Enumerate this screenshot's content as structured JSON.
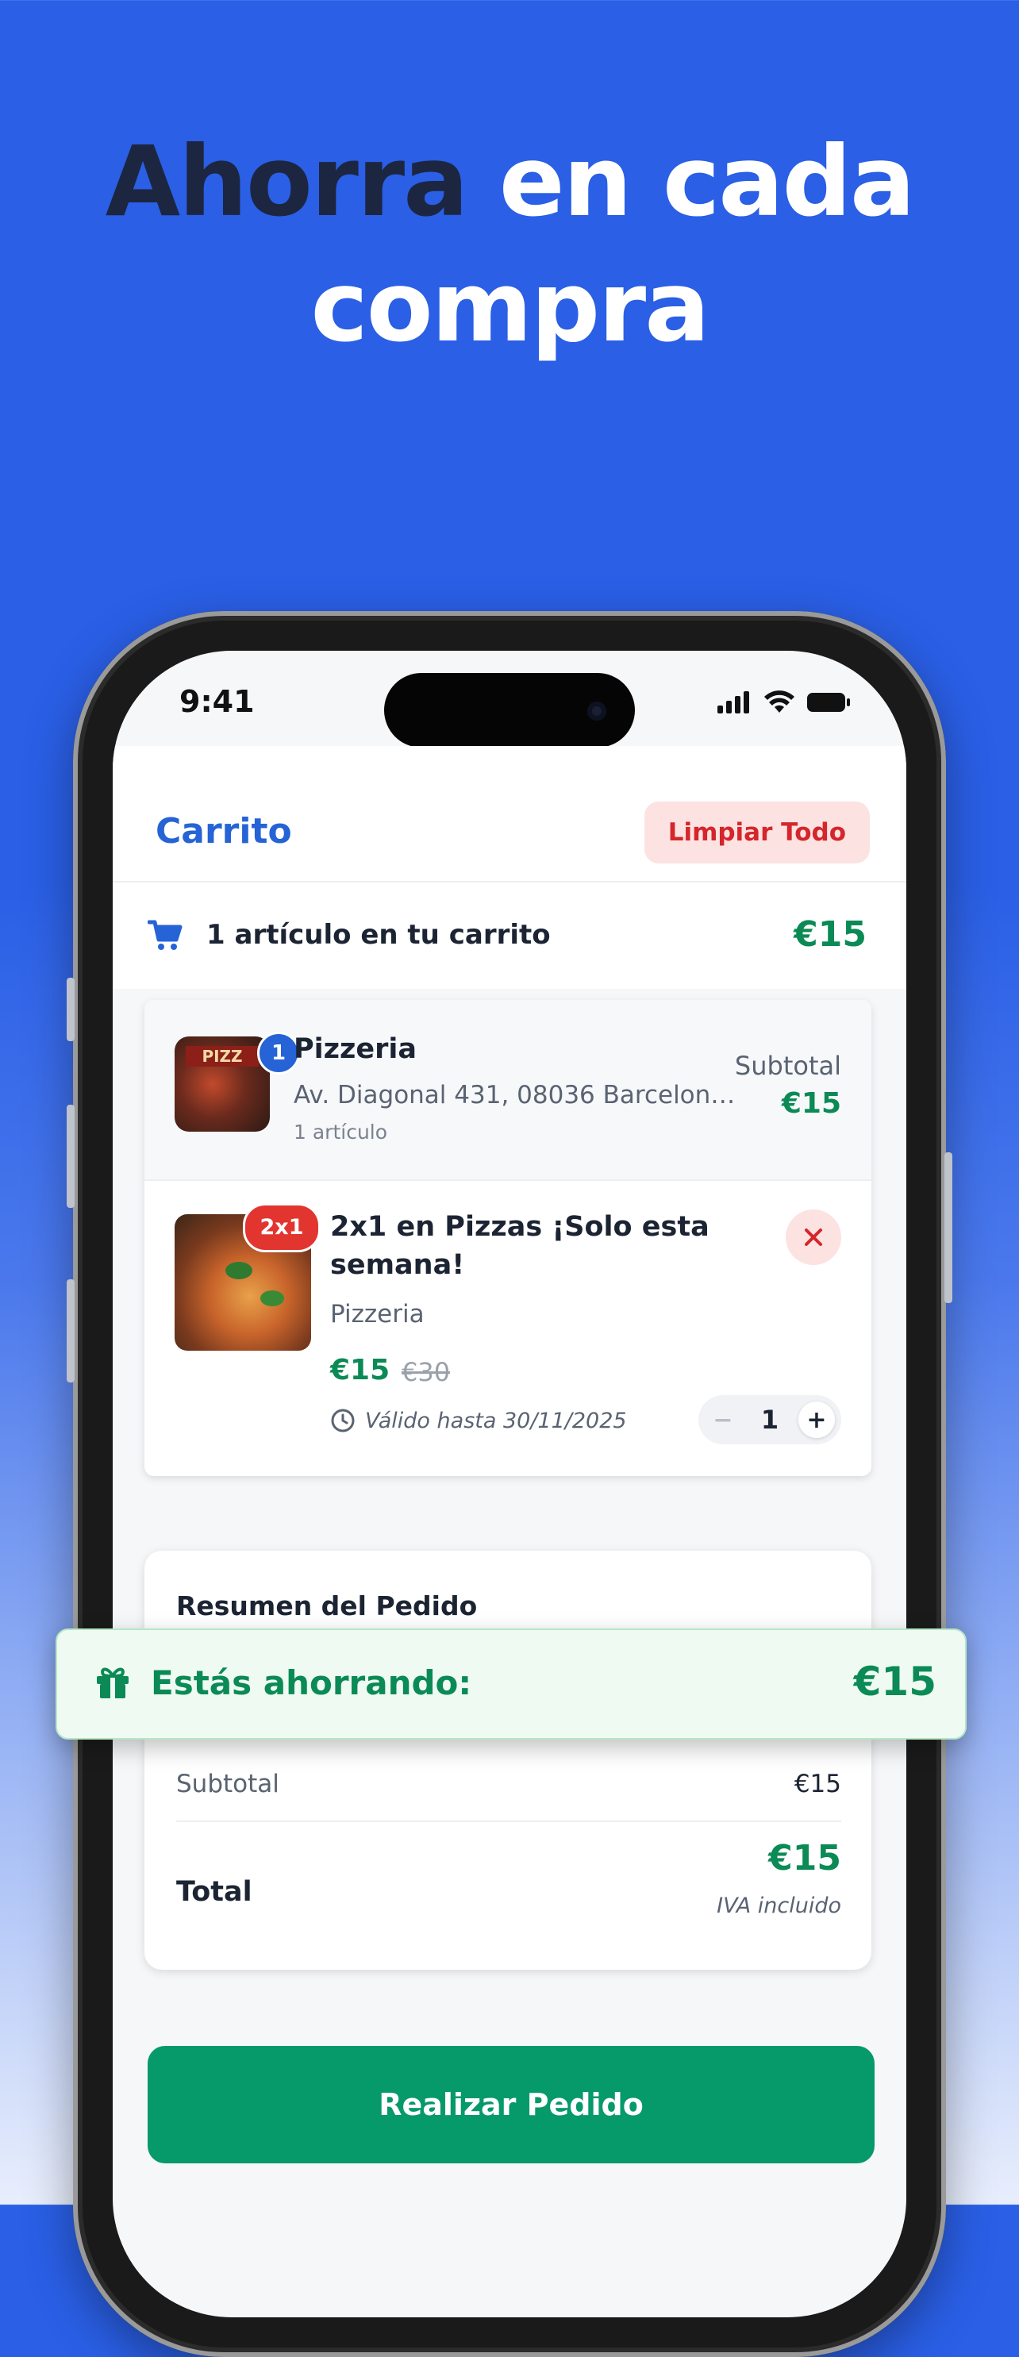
{
  "headline": {
    "dark": "Ahorra",
    "light_1": "en cada",
    "light_2": "compra"
  },
  "status_bar": {
    "time": "9:41"
  },
  "header": {
    "title": "Carrito",
    "clear_label": "Limpiar Todo"
  },
  "cart_bar": {
    "count_text": "1 artículo en tu carrito",
    "total": "€15"
  },
  "store": {
    "name": "Pizzeria",
    "badge": "1",
    "address": "Av. Diagonal 431, 08036 Barcelona,...",
    "items_text": "1 artículo",
    "subtotal_label": "Subtotal",
    "subtotal_value": "€15"
  },
  "offer": {
    "badge": "2x1",
    "title": "2x1 en Pizzas ¡Solo esta semana!",
    "store": "Pizzeria",
    "price": "€15",
    "old_price": "€30",
    "valid_text": "Válido hasta 30/11/2025",
    "quantity": "1",
    "minus": "−",
    "plus": "+"
  },
  "summary": {
    "title": "Resumen del Pedido",
    "subtotal_label": "Subtotal",
    "subtotal_value": "€15",
    "total_label": "Total",
    "total_value": "€15",
    "tax_note": "IVA incluido"
  },
  "savings": {
    "label": "Estás ahorrando:",
    "value": "€15"
  },
  "order_button": {
    "label": "Realizar Pedido"
  },
  "colors": {
    "brand_blue": "#2563d6",
    "green": "#0b8a55",
    "button_green": "#06996a",
    "danger": "#d4262b"
  }
}
